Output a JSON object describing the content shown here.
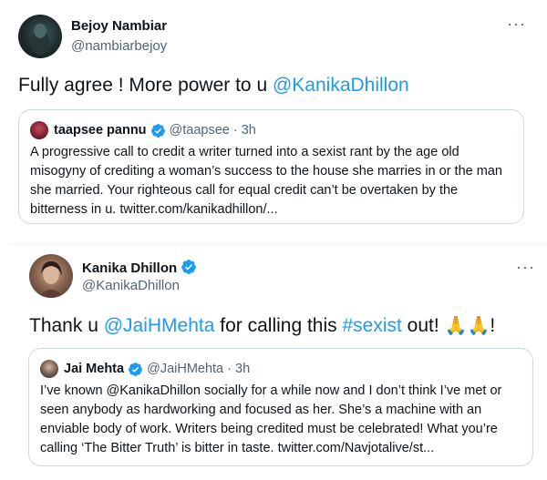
{
  "tweet1": {
    "name": "Bejoy Nambiar",
    "handle": "@nambiarbejoy",
    "body_text": "Fully agree ! More power to u ",
    "body_mention": "@KanikaDhillon",
    "more": "···",
    "quote": {
      "name": "taapsee pannu",
      "handle": "@taapsee · 3h",
      "text": "A progressive call to credit a writer turned into a sexist rant by the age old misogyny of crediting a woman’s success to the house she marries in or the man she married. Your righteous call for equal credit can’t be overtaken by the bitterness in u. twitter.com/kanikadhillon/..."
    }
  },
  "tweet2": {
    "name": "Kanika Dhillon",
    "handle": "@KanikaDhillon",
    "more": "···",
    "body_part1": "Thank u ",
    "body_mention": "@JaiHMehta",
    "body_part2": " for calling this ",
    "body_hashtag": "#sexist",
    "body_part3": " out! ",
    "body_emoji": "🙏🙏",
    "body_end": "!",
    "quote": {
      "name": "Jai Mehta",
      "handle": "@JaiHMehta · 3h",
      "text": "I’ve known @KanikaDhillon socially for a while now and I don’t think I’ve met or seen anybody as hardworking and focused as her. She’s a machine with an enviable body of work. Writers being credited must be celebrated! What you’re calling ‘The Bitter Truth’ is bitter in taste. twitter.com/Navjotalive/st..."
    }
  },
  "colors": {
    "link": "#1d9bf0",
    "verified": "#1d9bf0",
    "text": "#0f1419",
    "secondary": "#536471",
    "border": "#cfd9de"
  }
}
